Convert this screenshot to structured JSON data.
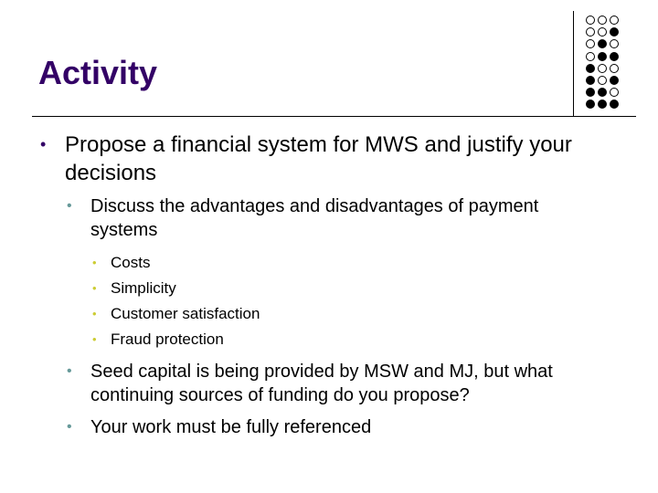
{
  "slide": {
    "title": "Activity",
    "decoration": {
      "dot_grid_rows": [
        [
          0,
          0,
          0
        ],
        [
          0,
          0,
          1
        ],
        [
          0,
          1,
          0
        ],
        [
          0,
          1,
          1
        ],
        [
          1,
          0,
          0
        ],
        [
          1,
          0,
          1
        ],
        [
          1,
          1,
          0
        ],
        [
          1,
          1,
          1
        ]
      ]
    },
    "colors": {
      "title": "#330066",
      "bullet_level1": "#330066",
      "bullet_level2": "#669999",
      "bullet_level3": "#cccc33"
    },
    "bullets": {
      "glyph": "•",
      "item1": {
        "text": "Propose a financial system for MWS and justify your decisions",
        "sub1": {
          "text": "Discuss the advantages and disadvantages of payment systems",
          "subitems": [
            "Costs",
            "Simplicity",
            "Customer satisfaction",
            "Fraud protection"
          ]
        },
        "sub2": {
          "text": "Seed capital is being provided by MSW and MJ, but what continuing sources of funding do you propose?"
        },
        "sub3": {
          "text": "Your work must be fully referenced"
        }
      }
    }
  }
}
